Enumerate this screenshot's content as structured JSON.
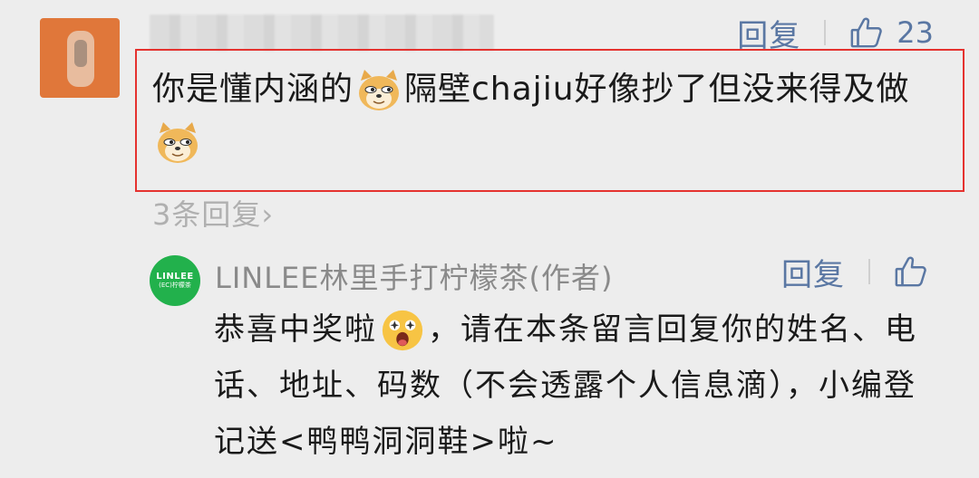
{
  "comment": {
    "reply_label": "回复",
    "like_count": "23",
    "text_part1": "你是懂内涵的",
    "text_part2": "隔壁chajiu好像抄了但没来得及做",
    "emoji_name": "doge-emoji",
    "replies_count": "3条回复",
    "replies_chevron": "›"
  },
  "reply": {
    "author": "LINLEE林里手打柠檬茶(作者)",
    "avatar_brand": "LINLEE",
    "avatar_sub": "(EC)柠檬茶",
    "reply_label": "回复",
    "text_part1": "恭喜中奖啦",
    "text_part2": "，请在本条留言回复你的姓名、电话、地址、码数（不会透露个人信息滴），小编登记送<鸭鸭洞洞鞋>啦~",
    "emoji_name": "surprised-emoji"
  },
  "colors": {
    "link": "#5a77a3",
    "highlight_border": "#e5322f",
    "avatar_green": "#22b14c",
    "avatar_orange": "#e0773a"
  }
}
